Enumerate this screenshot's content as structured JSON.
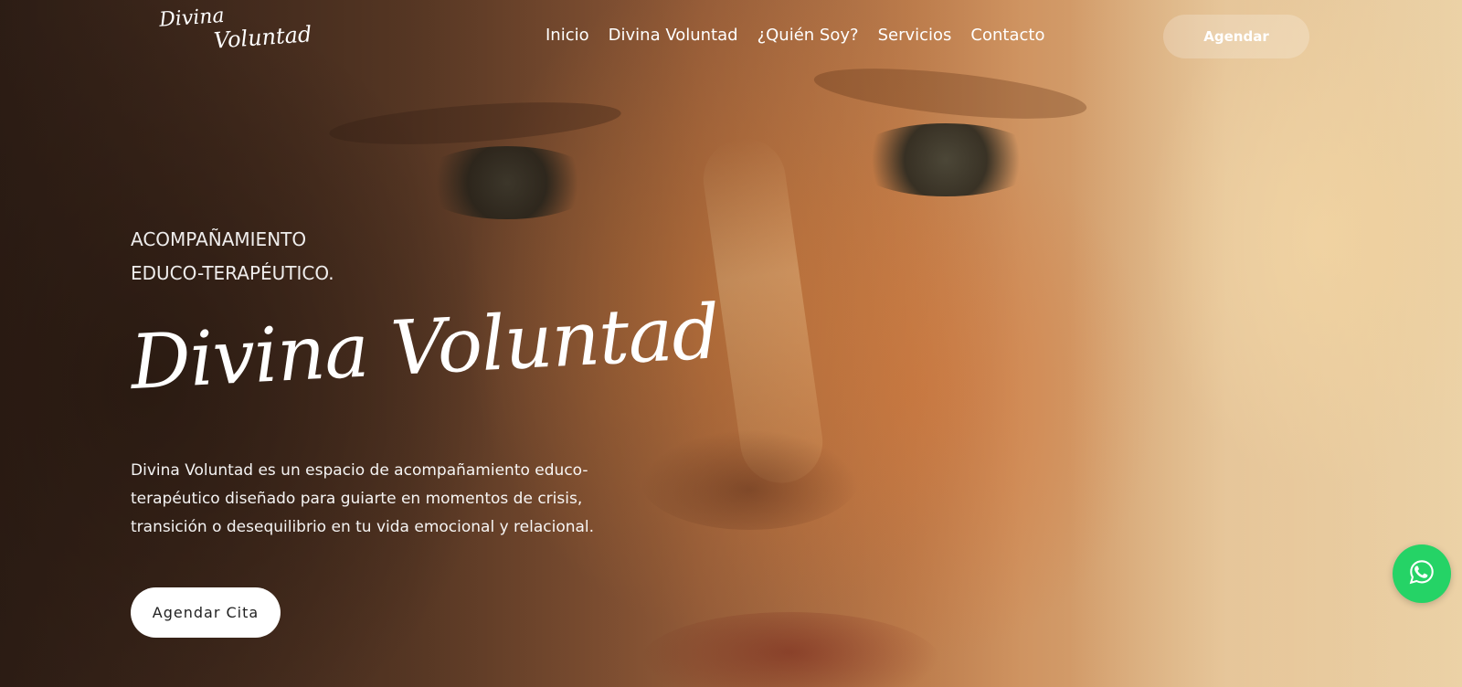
{
  "header": {
    "logo_line1": "Divina",
    "logo_line2": "Voluntad",
    "nav": [
      {
        "label": "Inicio"
      },
      {
        "label": "Divina Voluntad"
      },
      {
        "label": "¿Quién Soy?"
      },
      {
        "label": "Servicios"
      },
      {
        "label": "Contacto"
      }
    ],
    "cta_label": "Agendar"
  },
  "hero": {
    "kicker_line1": "ACOMPAÑAMIENTO",
    "kicker_line2": "EDUCO-TERAPÉUTICO.",
    "title": "Divina Voluntad",
    "description": "Divina Voluntad es un espacio de acompañamiento educo-terapéutico diseñado para guiarte en momentos de crisis, transición o desequilibrio en tu vida emocional y relacional.",
    "cta_label": "Agendar Cita"
  },
  "floating": {
    "whatsapp_icon": "whatsapp-icon",
    "whatsapp_color": "#25d366"
  }
}
